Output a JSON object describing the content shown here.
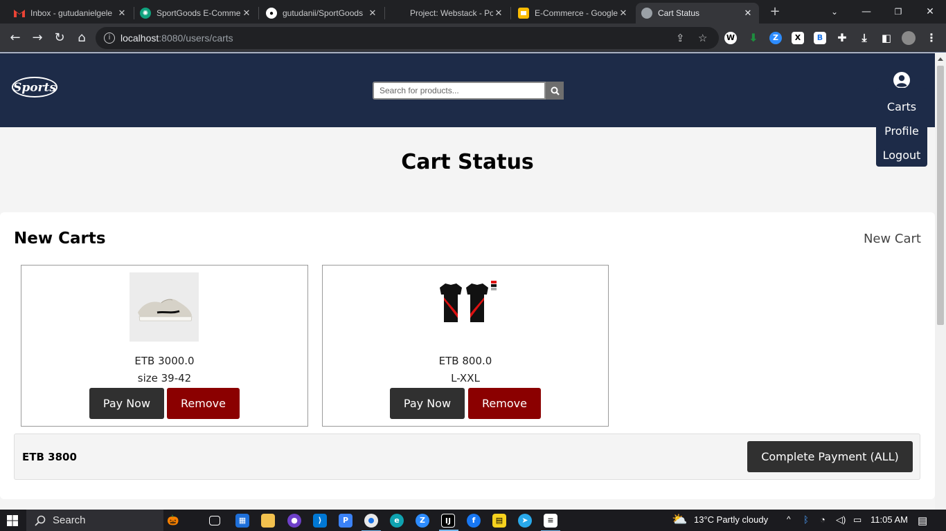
{
  "browser": {
    "tabs": [
      {
        "title": "Inbox - gutudanielgele",
        "icon": "gmail-icon",
        "color": "#ea4335",
        "active": false
      },
      {
        "title": "SportGoods E-Comme",
        "icon": "chatgpt-icon",
        "color": "#10a37f",
        "active": false
      },
      {
        "title": "gutudanii/SportGoods",
        "icon": "github-icon",
        "color": "#ffffff",
        "active": false
      },
      {
        "title": "Project: Webstack - Po",
        "icon": "blank-icon",
        "color": "#202124",
        "active": false
      },
      {
        "title": "E-Commerce - Google",
        "icon": "google-slides-icon",
        "color": "#fbbc04",
        "active": false
      },
      {
        "title": "Cart Status",
        "icon": "globe-icon",
        "color": "#9aa0a6",
        "active": true
      }
    ],
    "url_host": "localhost",
    "url_path": ":8080/users/carts"
  },
  "site": {
    "logo_text": "Sports",
    "search_placeholder": "Search for products...",
    "menu": {
      "carts": "Carts",
      "profile": "Profile",
      "logout": "Logout"
    },
    "colors": {
      "header_bg": "#1d2b48",
      "pay_button": "#303030",
      "remove_button": "#8b0000"
    }
  },
  "page": {
    "title": "Cart Status",
    "section_title": "New Carts",
    "new_cart_link": "New Cart",
    "carts": [
      {
        "price": "ETB 3000.0",
        "size": "size 39-42",
        "pay_label": "Pay Now",
        "remove_label": "Remove",
        "image": "sneaker-image"
      },
      {
        "price": "ETB 800.0",
        "size": "L-XXL",
        "pay_label": "Pay Now",
        "remove_label": "Remove",
        "image": "jersey-image"
      }
    ],
    "total": "ETB 3800",
    "complete_label": "Complete Payment (ALL)"
  },
  "taskbar": {
    "search_label": "Search",
    "weather": "13°C  Partly cloudy",
    "time": "11:05 AM"
  }
}
